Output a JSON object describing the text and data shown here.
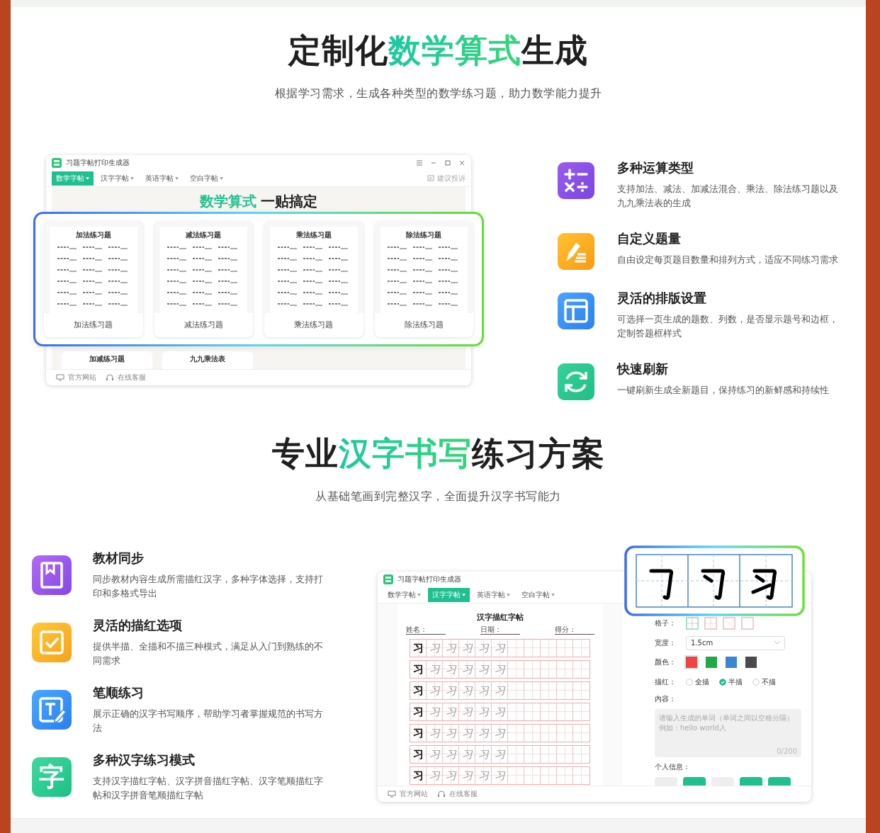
{
  "math_section": {
    "title": [
      {
        "text": "定制化",
        "highlight": false
      },
      {
        "text": "数学算式",
        "highlight": true
      },
      {
        "text": "生成",
        "highlight": false
      }
    ],
    "subtitle": "根据学习需求，生成各种类型的数学练习题，助力数学能力提升",
    "app": {
      "title": "习题字帖打印生成器",
      "tabs": [
        {
          "label": "数学字帖",
          "selected": true
        },
        {
          "label": "汉字字帖",
          "selected": false
        },
        {
          "label": "英语字帖",
          "selected": false
        },
        {
          "label": "空白字帖",
          "selected": false
        }
      ],
      "feedback": "建议投诉",
      "banner": [
        {
          "text": "数学算式",
          "highlight": true
        },
        {
          "text": " 一贴搞定",
          "highlight": false
        }
      ],
      "cards": [
        {
          "sheet_title": "加法练习题",
          "label": "加法练习题"
        },
        {
          "sheet_title": "减法练习题",
          "label": "减法练习题"
        },
        {
          "sheet_title": "乘法练习题",
          "label": "乘法练习题"
        },
        {
          "sheet_title": "除法练习题",
          "label": "除法练习题"
        }
      ],
      "more_cards": [
        {
          "sheet_title": "加减练习题"
        },
        {
          "sheet_title": "九九乘法表"
        }
      ],
      "footer": [
        "官方网站",
        "在线客服"
      ]
    },
    "features": [
      {
        "kind": "math",
        "title": "多种运算类型",
        "desc": "支持加法、减法、加减法混合、乘法、除法练习题以及九九乘法表的生成"
      },
      {
        "kind": "pencil",
        "title": "自定义题量",
        "desc": "自由设定每页题目数量和排列方式，适应不同练习需求"
      },
      {
        "kind": "layout",
        "title": "灵活的排版设置",
        "desc": "可选择一页生成的题数、列数，是否显示题号和边框，定制答题框样式"
      },
      {
        "kind": "refresh",
        "title": "快速刷新",
        "desc": "一键刷新生成全新题目，保持练习的新鲜感和持续性"
      }
    ]
  },
  "hanzi_section": {
    "title": [
      {
        "text": "专业",
        "highlight": false
      },
      {
        "text": "汉字书写",
        "highlight": true
      },
      {
        "text": "练习方案",
        "highlight": false
      }
    ],
    "subtitle": "从基础笔画到完整汉字，全面提升汉字书写能力",
    "features": [
      {
        "kind": "book",
        "title": "教材同步",
        "desc": "同步教材内容生成所需描红汉字，多种字体选择，支持打印和多格式导出"
      },
      {
        "kind": "checkbox",
        "title": "灵活的描红选项",
        "desc": "提供半描、全描和不描三种模式，满足从入门到熟练的不同需求"
      },
      {
        "kind": "edit",
        "title": "笔顺练习",
        "desc": "展示正确的汉字书写顺序，帮助学习者掌握规范的书写方法"
      },
      {
        "kind": "glyph",
        "glyph": "字",
        "title": "多种汉字练习模式",
        "desc": "支持汉字描红字帖、汉字拼音描红字帖、汉字笔顺描红字帖和汉字拼音笔顺描红字帖"
      }
    ],
    "app": {
      "title": "习题字帖打印生成器",
      "tabs": [
        {
          "label": "数学字帖",
          "selected": false
        },
        {
          "label": "汉字字帖",
          "selected": true
        },
        {
          "label": "英语字帖",
          "selected": false
        },
        {
          "label": "空白字帖",
          "selected": false
        }
      ],
      "sheet": {
        "title": "汉字描红字帖",
        "fields": [
          "姓名：",
          "日期：",
          "得分："
        ],
        "rows": [
          {
            "model": "习",
            "traces": [
              "习",
              "习",
              "习",
              "习",
              "习"
            ]
          },
          {
            "model": "习",
            "traces": [
              "习",
              "习",
              "习",
              "习",
              "习"
            ]
          },
          {
            "model": "习",
            "traces": [
              "习",
              "习",
              "习",
              "习",
              "习"
            ]
          },
          {
            "model": "习",
            "traces": [
              "习",
              "习",
              "习",
              "习",
              "习"
            ]
          },
          {
            "model": "习",
            "traces": [
              "习",
              "习",
              "习",
              "习",
              "习"
            ]
          },
          {
            "model": "习",
            "traces": [
              "习",
              "习",
              "习",
              "习",
              "习"
            ]
          },
          {
            "model": "习",
            "traces": [
              "习",
              "习",
              "习",
              "习",
              "习"
            ]
          }
        ]
      },
      "settings": {
        "grid_label": "格子：",
        "grid_options": [
          {
            "kind": "cross",
            "selected": true
          },
          {
            "kind": "cross-dashed",
            "selected": false
          },
          {
            "kind": "diagonal",
            "selected": false
          },
          {
            "kind": "blank",
            "selected": false
          }
        ],
        "width_label": "宽度：",
        "width_value": "1.5cm",
        "color_label": "颜色：",
        "colors": [
          {
            "color": "#f04444",
            "selected": true
          },
          {
            "color": "#22a844",
            "selected": false
          },
          {
            "color": "#3a86d0",
            "selected": false
          },
          {
            "color": "#4a4a4a",
            "selected": false
          }
        ],
        "trace_label": "描红：",
        "trace_options": [
          {
            "label": "全描",
            "selected": false
          },
          {
            "label": "半描",
            "selected": true
          },
          {
            "label": "不描",
            "selected": false
          }
        ],
        "content_label": "内容：",
        "content_placeholder": "请输入生成的单词（单词之间以空格分隔）例如：hello world入",
        "counter": "0/200",
        "info_label": "个人信息：",
        "info_buttons": [
          {
            "selected": false
          },
          {
            "selected": true
          },
          {
            "selected": false
          },
          {
            "selected": true
          },
          {
            "selected": true
          }
        ]
      },
      "footer": [
        "官方网站",
        "在线客服"
      ]
    }
  }
}
